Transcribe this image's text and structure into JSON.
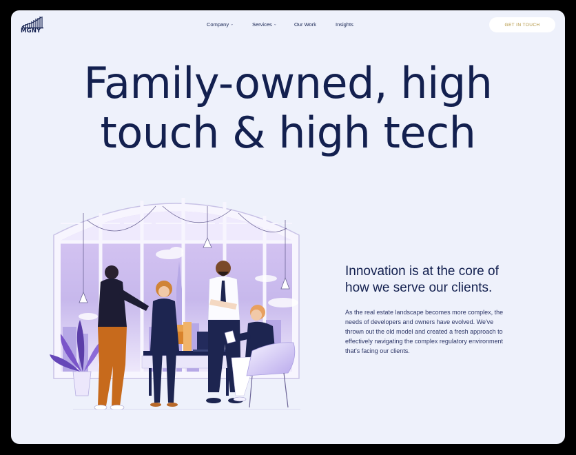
{
  "header": {
    "logo_text": "MGNY",
    "nav": [
      {
        "label": "Company",
        "has_dropdown": true
      },
      {
        "label": "Services",
        "has_dropdown": true
      },
      {
        "label": "Our Work",
        "has_dropdown": false
      },
      {
        "label": "Insights",
        "has_dropdown": false
      }
    ],
    "cta_label": "GET IN TOUCH",
    "chevron": "⌄"
  },
  "hero": {
    "title_line1": "Family-owned, high",
    "title_line2": "touch & high tech"
  },
  "section": {
    "heading_line1": "Innovation is at the core of",
    "heading_line2": "how we serve our clients.",
    "body_lines": [
      "As the real estate landscape becomes more complex, the",
      "needs of developers and owners have evolved. We've",
      "thrown out the old model and created a fresh approach to",
      "effectively navigating the complex regulatory environment",
      "that's facing our clients."
    ]
  },
  "colors": {
    "navy": "#13204f",
    "background": "#eef1fb",
    "cta_text": "#b0913a",
    "accent_orange": "#d9822b",
    "accent_lavender": "#c9b8ef"
  },
  "icons": {
    "logo": "building-skyline-icon",
    "dropdown": "chevron-down-icon"
  }
}
